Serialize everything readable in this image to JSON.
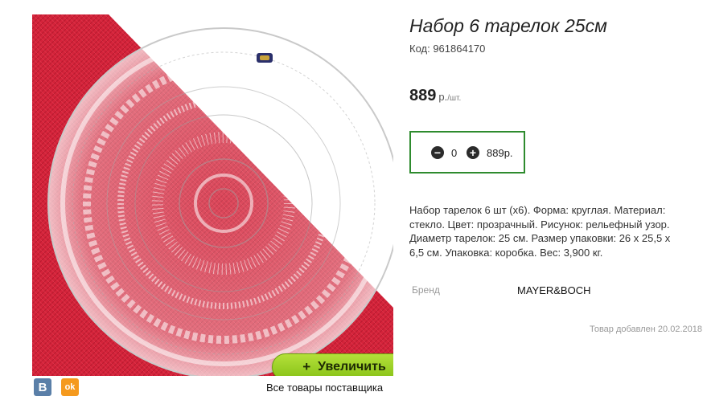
{
  "product": {
    "title": "Набор 6 тарелок 25см",
    "code": "Код: 961864170",
    "price_value": "889",
    "price_currency": "р.",
    "price_unit": "/шт.",
    "description": "Набор тарелок 6 шт (х6). Форма: круглая. Материал: стекло. Цвет: прозрачный. Рисунок: рельефный узор. Диаметр тарелок: 25 см. Размер упаковки: 26 х 25,5 х 6,5 см. Упаковка: коробка. Вес: 3,900 кг.",
    "brand_label": "Бренд",
    "brand_value": "MAYER&BOCH",
    "added": "Товар добавлен 20.02.2018"
  },
  "quantity": {
    "minus_icon": "minus-circle-icon",
    "plus_icon": "plus-circle-icon",
    "value": "0",
    "sum": "889р."
  },
  "image": {
    "zoom_label": "Увеличить",
    "zoom_icon": "+"
  },
  "social": {
    "vk_label": "B",
    "ok_label": "ok"
  },
  "links": {
    "supplier": "Все товары поставщика"
  },
  "colors": {
    "accent_green": "#2e8b2e",
    "button_green": "#9acd32",
    "tablecloth_red": "#d9263a"
  }
}
